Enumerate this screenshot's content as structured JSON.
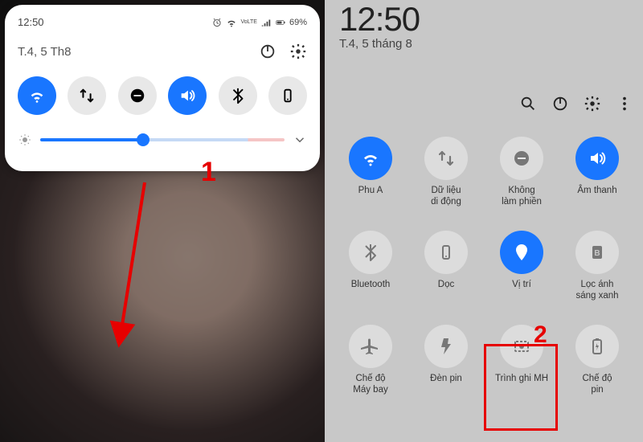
{
  "left": {
    "time": "12:50",
    "battery": "69%",
    "date": "T.4, 5 Th8",
    "status_volte": "VoLTE",
    "brightness_pct": 42,
    "qs": [
      {
        "name": "wifi",
        "active": true
      },
      {
        "name": "data",
        "active": false
      },
      {
        "name": "dnd",
        "active": false
      },
      {
        "name": "sound",
        "active": true
      },
      {
        "name": "bt",
        "active": false
      },
      {
        "name": "rotate",
        "active": false
      }
    ]
  },
  "right": {
    "time": "12:50",
    "date": "T.4, 5 tháng 8",
    "tiles": [
      {
        "name": "wifi",
        "label": "Phu A",
        "active": true
      },
      {
        "name": "data",
        "label": "Dữ liệu\ndi động",
        "active": false
      },
      {
        "name": "dnd",
        "label": "Không\nlàm phiền",
        "active": false
      },
      {
        "name": "sound",
        "label": "Âm thanh",
        "active": true
      },
      {
        "name": "bt",
        "label": "Bluetooth",
        "active": false
      },
      {
        "name": "rotate",
        "label": "Dọc",
        "active": false
      },
      {
        "name": "location",
        "label": "Vị trí",
        "active": true
      },
      {
        "name": "bluelight",
        "label": "Lọc ánh\nsáng xanh",
        "active": false
      },
      {
        "name": "airplane",
        "label": "Chế độ\nMáy bay",
        "active": false
      },
      {
        "name": "flashlight",
        "label": "Đèn pin",
        "active": false
      },
      {
        "name": "screenrec",
        "label": "Trình ghi MH",
        "active": false
      },
      {
        "name": "battery",
        "label": "Chế độ\npin",
        "active": false
      }
    ]
  },
  "annotations": {
    "step1": "1",
    "step2": "2"
  }
}
